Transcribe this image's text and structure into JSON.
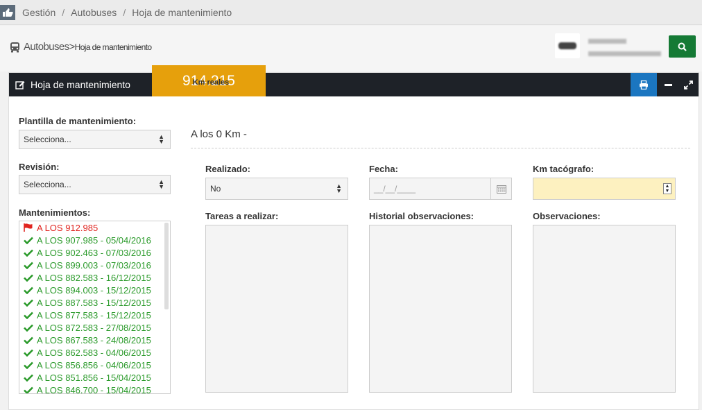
{
  "breadcrumb": {
    "items": [
      "Gestión",
      "Autobuses",
      "Hoja de mantenimiento"
    ],
    "separator": "/"
  },
  "header": {
    "title_main": "Autobuses",
    "title_sep": ">",
    "title_sub": "Hoja de mantenimiento"
  },
  "panel": {
    "title": "Hoja de mantenimiento",
    "km_value": "914.215",
    "km_label": "Km reales"
  },
  "left": {
    "plantilla_label": "Plantilla de mantenimiento:",
    "plantilla_value": "Selecciona...",
    "revision_label": "Revisión:",
    "revision_value": "Selecciona...",
    "mantenimientos_label": "Mantenimientos:",
    "items": [
      "A LOS 912.985",
      "A LOS 907.985 - 05/04/2016",
      "A LOS 902.463 - 07/03/2016",
      "A LOS 899.003 - 07/03/2016",
      "A LOS 882.583 - 16/12/2015",
      "A LOS 894.003 - 15/12/2015",
      "A LOS 887.583 - 15/12/2015",
      "A LOS 877.583 - 15/12/2015",
      "A LOS 872.583 - 27/08/2015",
      "A LOS 867.583 - 24/08/2015",
      "A LOS 862.583 - 04/06/2015",
      "A LOS 856.856 - 04/06/2015",
      "A LOS 851.856 - 15/04/2015",
      "A LOS 846.700 - 15/04/2015"
    ]
  },
  "main": {
    "section_title": "A los 0 Km -",
    "realizado_label": "Realizado:",
    "realizado_value": "No",
    "fecha_label": "Fecha:",
    "fecha_placeholder": "__/__/____",
    "km_tacografo_label": "Km tacógrafo:",
    "tareas_label": "Tareas a realizar:",
    "historial_label": "Historial observaciones:",
    "observaciones_label": "Observaciones:"
  },
  "colors": {
    "accent_orange": "#e6a00c",
    "search_green": "#157a35",
    "print_blue": "#1b76c0",
    "header_dark": "#1e2228",
    "done_green": "#2a9a2a",
    "flag_red": "#e0241f",
    "km_input_bg": "#fdf1c0"
  },
  "icons": {
    "home": "thumb-pointer-icon",
    "bus": "bus-icon",
    "search": "search-icon",
    "edit": "edit-icon",
    "print": "print-icon",
    "minimize": "minus-icon",
    "expand": "expand-icon",
    "calendar": "calendar-icon",
    "flag": "flag-icon",
    "check": "check-icon"
  }
}
